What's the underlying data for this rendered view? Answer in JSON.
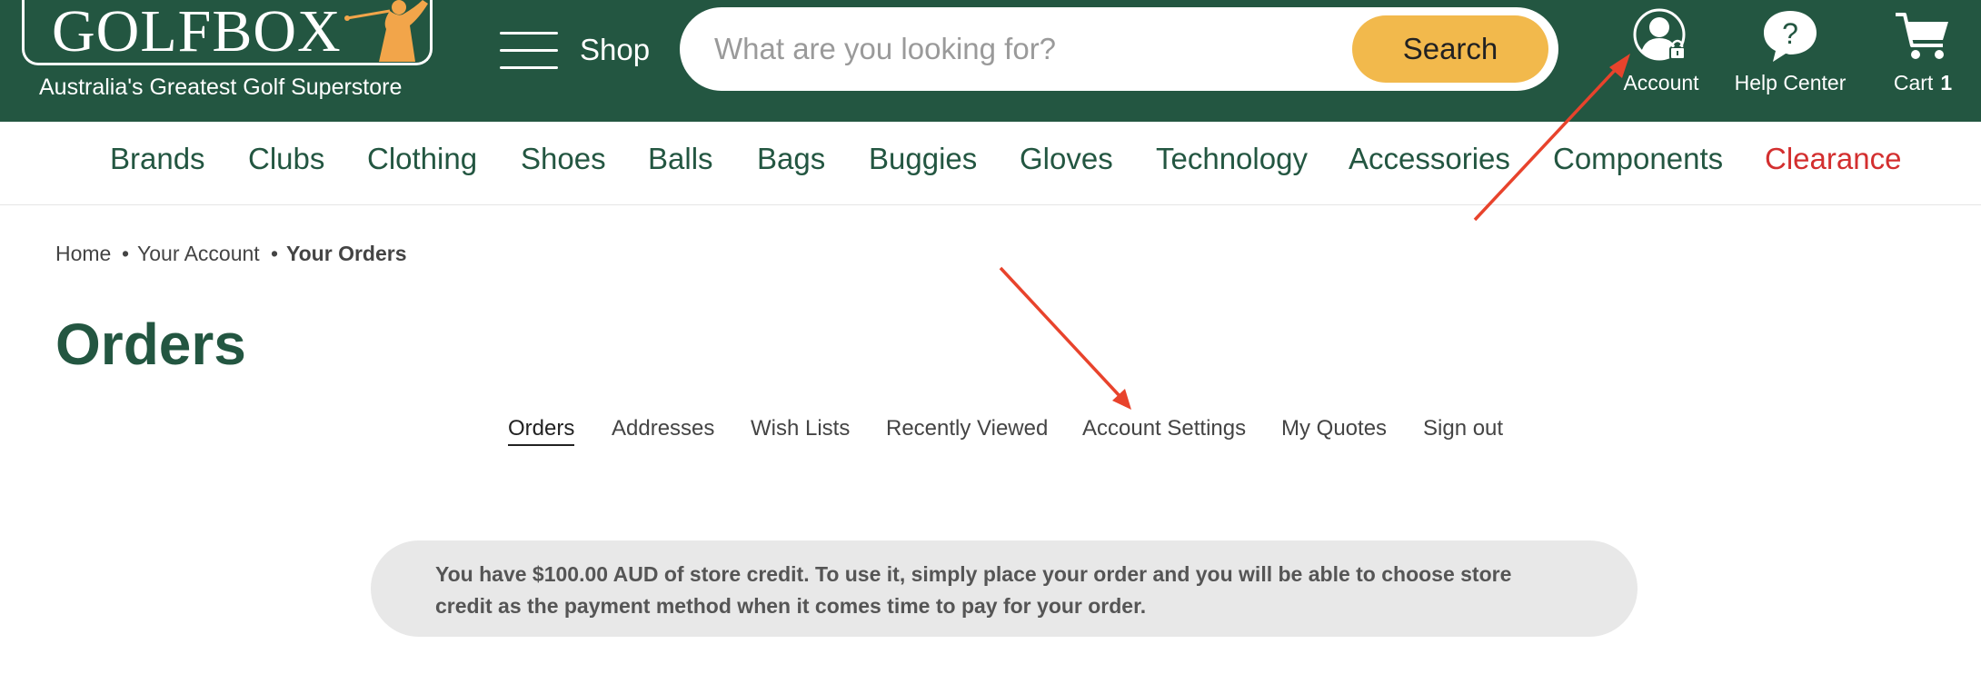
{
  "header": {
    "logo_text": "GOLFBOX",
    "tagline": "Australia's Greatest Golf Superstore",
    "shop_label": "Shop",
    "search_placeholder": "What are you looking for?",
    "search_button": "Search",
    "account_label": "Account",
    "help_label": "Help Center",
    "help_glyph": "?",
    "cart_label": "Cart",
    "cart_count": "1",
    "icons": [
      "hamburger-icon",
      "golfer-logo-icon",
      "account-lock-icon",
      "help-bubble-icon",
      "cart-icon"
    ]
  },
  "nav": {
    "items": [
      {
        "label": "Brands"
      },
      {
        "label": "Clubs"
      },
      {
        "label": "Clothing"
      },
      {
        "label": "Shoes"
      },
      {
        "label": "Balls"
      },
      {
        "label": "Bags"
      },
      {
        "label": "Buggies"
      },
      {
        "label": "Gloves"
      },
      {
        "label": "Technology"
      },
      {
        "label": "Accessories"
      },
      {
        "label": "Components"
      },
      {
        "label": "Clearance"
      }
    ]
  },
  "breadcrumb": {
    "items": [
      {
        "label": "Home"
      },
      {
        "label": "Your Account"
      },
      {
        "label": "Your Orders"
      }
    ],
    "separator": "•"
  },
  "page": {
    "title": "Orders"
  },
  "account_tabs": {
    "active": "Orders",
    "items": [
      {
        "label": "Orders"
      },
      {
        "label": "Addresses"
      },
      {
        "label": "Wish Lists"
      },
      {
        "label": "Recently Viewed"
      },
      {
        "label": "Account Settings"
      },
      {
        "label": "My Quotes"
      },
      {
        "label": "Sign out"
      }
    ]
  },
  "notice": {
    "text": "You have $100.00 AUD of store credit. To use it, simply place your order and you will be able to choose store credit as the payment method when it comes time to pay for your order."
  },
  "colors": {
    "brand_green": "#235641",
    "search_button": "#f2b94c",
    "clearance_red": "#d32f2f",
    "annotation_arrow": "#e8432c",
    "notice_bg": "#e8e8e8"
  }
}
